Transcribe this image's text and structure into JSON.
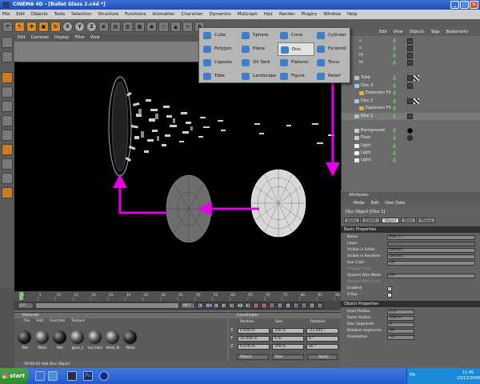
{
  "window": {
    "title": "CINEMA 4D - [Bullet Glass 2.c4d *]"
  },
  "menubar": [
    "File",
    "Edit",
    "Objects",
    "Tools",
    "Selection",
    "Structure",
    "Functions",
    "Animation",
    "Character",
    "Dynamics",
    "MoGraph",
    "Hair",
    "Render",
    "Plugins",
    "Window",
    "Help"
  ],
  "toolbar": {
    "axis_buttons": [
      "X",
      "Y",
      "Z"
    ]
  },
  "viewport_menu": [
    "Edit",
    "Cameras",
    "Display",
    "Filter",
    "View"
  ],
  "dropdown": {
    "items": [
      {
        "label": "Cube",
        "icon": "cube-icon"
      },
      {
        "label": "Sphere",
        "icon": "sphere-icon"
      },
      {
        "label": "Cone",
        "icon": "cone-icon"
      },
      {
        "label": "Cylinder",
        "icon": "cylinder-icon"
      },
      {
        "label": "Polygon",
        "icon": "polygon-icon"
      },
      {
        "label": "Plane",
        "icon": "plane-icon"
      },
      {
        "label": "Disc",
        "icon": "disc-icon"
      },
      {
        "label": "Pyramid",
        "icon": "pyramid-icon"
      },
      {
        "label": "Capsule",
        "icon": "capsule-icon"
      },
      {
        "label": "Oil Tank",
        "icon": "oiltank-icon"
      },
      {
        "label": "Platonic",
        "icon": "platonic-icon"
      },
      {
        "label": "Torus",
        "icon": "torus-icon"
      },
      {
        "label": "Tube",
        "icon": "tube-icon"
      },
      {
        "label": "Landscape",
        "icon": "landscape-icon"
      },
      {
        "label": "Figure",
        "icon": "figure-icon"
      },
      {
        "label": "Relief",
        "icon": "relief-icon"
      }
    ],
    "highlighted": "Disc"
  },
  "object_manager": {
    "menu": [
      "Edit",
      "View",
      "Objects",
      "Tags",
      "Bookmarks"
    ],
    "rows": [
      {
        "name": "c"
      },
      {
        "name": "s"
      },
      {
        "name": "ht"
      },
      {
        "name": "ht"
      },
      {
        "name": "Tube"
      },
      {
        "name": "Disc 3"
      },
      {
        "name": "Explosion FX"
      },
      {
        "name": "Disc 2"
      },
      {
        "name": "Explosion FX"
      },
      {
        "name": "Disc 1"
      },
      {
        "name": "Background"
      },
      {
        "name": "Floor"
      },
      {
        "name": "Light"
      },
      {
        "name": "Light"
      },
      {
        "name": "Light"
      }
    ]
  },
  "attributes": {
    "panel_title": "Attributes",
    "menu": [
      "Mode",
      "Edit",
      "User Data"
    ],
    "object_title": "Disc Object [Disc 1]",
    "tabs": [
      "Basic",
      "Coord.",
      "Object",
      "Slice",
      "Phong"
    ],
    "basic_header": "Basic Properties",
    "basic": [
      {
        "label": "Name",
        "value": "Disc 1"
      },
      {
        "label": "Layer",
        "value": ""
      },
      {
        "label": "Visible in Editor",
        "value": "Default"
      },
      {
        "label": "Visible in Renderer",
        "value": "Default"
      },
      {
        "label": "Use Color",
        "value": "Off"
      },
      {
        "label": "Display Color",
        "value": ""
      },
      {
        "label": "Shaded Wire Mode",
        "value": "Off"
      },
      {
        "label": "Shaded Wire Color",
        "value": ""
      },
      {
        "label": "Enabled",
        "value": "✓"
      },
      {
        "label": "X-Ray",
        "value": ""
      }
    ],
    "object_header": "Object Properties",
    "object": [
      {
        "label": "Inner Radius",
        "value": "0 m"
      },
      {
        "label": "Outer Radius",
        "value": "100 m"
      },
      {
        "label": "Disc Segments",
        "value": "2"
      },
      {
        "label": "Rotation Segments",
        "value": "36"
      },
      {
        "label": "Orientation",
        "value": "+Z"
      }
    ]
  },
  "timeline": {
    "ticks": [
      "0",
      "5",
      "10",
      "15",
      "20",
      "25",
      "30",
      "35",
      "40",
      "45",
      "50",
      "55",
      "60",
      "65",
      "70",
      "75",
      "80",
      "85",
      "90"
    ],
    "frame_field": "0 F",
    "start_field": "0 F",
    "end_field": "90 F",
    "current_frame": "0 F"
  },
  "materials": {
    "title": "Materials",
    "menu": [
      "File",
      "Edit",
      "Function",
      "Texture"
    ],
    "items": [
      "Mat",
      "Metal",
      "Mat",
      "glass_1",
      "bal_black",
      "Metal_Bl",
      "Metal"
    ]
  },
  "coordinates": {
    "title": "Coordinates",
    "headers": [
      "Position",
      "Size",
      "Rotation"
    ],
    "rows": [
      {
        "axis": "X",
        "pos": "0.609 m",
        "size": "200 m",
        "rot": "-23.495 °",
        "rl": "H"
      },
      {
        "axis": "Y",
        "pos": "16.458 m",
        "size": "0 m",
        "rot": "0 °",
        "rl": "P"
      },
      {
        "axis": "Z",
        "pos": "0.076 m",
        "size": "200 m",
        "rot": "90 °",
        "rl": "B"
      }
    ],
    "mode_object": "Object",
    "mode_size": "Size",
    "apply": "Apply"
  },
  "status": {
    "text": "00:00:00  Add Disc Object"
  },
  "taskbar": {
    "start": "start",
    "lang": "EN",
    "time": "11:45",
    "date": "23/12/2009"
  },
  "colors": {
    "arrow": "#e600e6",
    "taskbar": "#245cd0",
    "highlight": "#e2e2e2"
  }
}
